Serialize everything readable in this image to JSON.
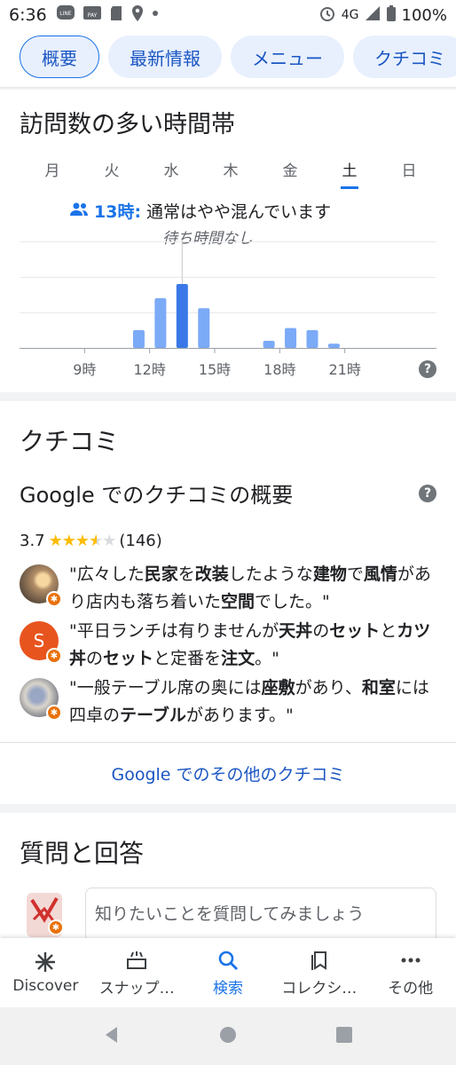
{
  "status_bar": {
    "time": "6:36",
    "network": "4G",
    "battery": "100%",
    "notif_icons": [
      "line-icon",
      "pay-icon",
      "sd-card-icon",
      "location-icon",
      "dot-icon"
    ]
  },
  "tabs": [
    {
      "label": "概要",
      "active": true
    },
    {
      "label": "最新情報",
      "active": false
    },
    {
      "label": "メニュー",
      "active": false
    },
    {
      "label": "クチコミ",
      "active": false
    }
  ],
  "popular_times": {
    "title": "訪問数の多い時間帯",
    "days": [
      "月",
      "火",
      "水",
      "木",
      "金",
      "土",
      "日"
    ],
    "selected_day": "土",
    "live_hour": "13時:",
    "live_status": "通常はやや混んでいます",
    "wait_text": "待ち時間なし",
    "help": "?"
  },
  "chart_data": {
    "type": "bar",
    "categories": [
      "6",
      "7",
      "8",
      "9",
      "10",
      "11",
      "12",
      "13",
      "14",
      "15",
      "16",
      "17",
      "18",
      "19",
      "20",
      "21",
      "22",
      "23"
    ],
    "values": [
      0,
      0,
      0,
      0,
      0,
      25,
      70,
      90,
      56,
      0,
      0,
      10,
      28,
      25,
      6,
      0,
      0,
      0
    ],
    "highlight_category": "13",
    "tick_labels": [
      "9時",
      "12時",
      "15時",
      "18時",
      "21時"
    ],
    "ylim": [
      0,
      100
    ],
    "grid": true,
    "colors": {
      "bar": "#7baaf7",
      "highlight": "#3b78e7",
      "grid": "#e8eaed"
    }
  },
  "reviews": {
    "title": "クチコミ",
    "overview_title": "Google でのクチコミの概要",
    "rating": "3.7",
    "stars": 3.7,
    "count": "(146)",
    "items": [
      {
        "parts": [
          "\"広々した",
          "民家",
          "を",
          "改装",
          "したような",
          "建物",
          "で",
          "風情",
          "があり店内も落ち着いた",
          "空間",
          "でした。\""
        ],
        "avatar": "photo-sunset",
        "initial": ""
      },
      {
        "parts": [
          "\"平日ランチは有りませんが",
          "天丼",
          "の",
          "セット",
          "と",
          "カツ丼",
          "の",
          "セット",
          "と定番を",
          "注文",
          "。\""
        ],
        "avatar": "letter",
        "initial": "S"
      },
      {
        "parts": [
          "\"一般テーブル席の奥には",
          "座敷",
          "があり、",
          "和室",
          "には四卓の",
          "テーブル",
          "があります。\""
        ],
        "avatar": "photo-person",
        "initial": ""
      }
    ],
    "more_link": "Google でのその他のクチコミ"
  },
  "qa": {
    "title": "質問と回答",
    "placeholder": "知りたいことを質問してみましょう"
  },
  "bottom_nav": [
    {
      "label": "Discover",
      "icon": "asterisk-icon",
      "active": false
    },
    {
      "label": "スナップ…",
      "icon": "snapshot-icon",
      "active": false
    },
    {
      "label": "検索",
      "icon": "search-icon",
      "active": true
    },
    {
      "label": "コレクシ…",
      "icon": "bookmark-icon",
      "active": false
    },
    {
      "label": "その他",
      "icon": "more-dots-icon",
      "active": false
    }
  ]
}
